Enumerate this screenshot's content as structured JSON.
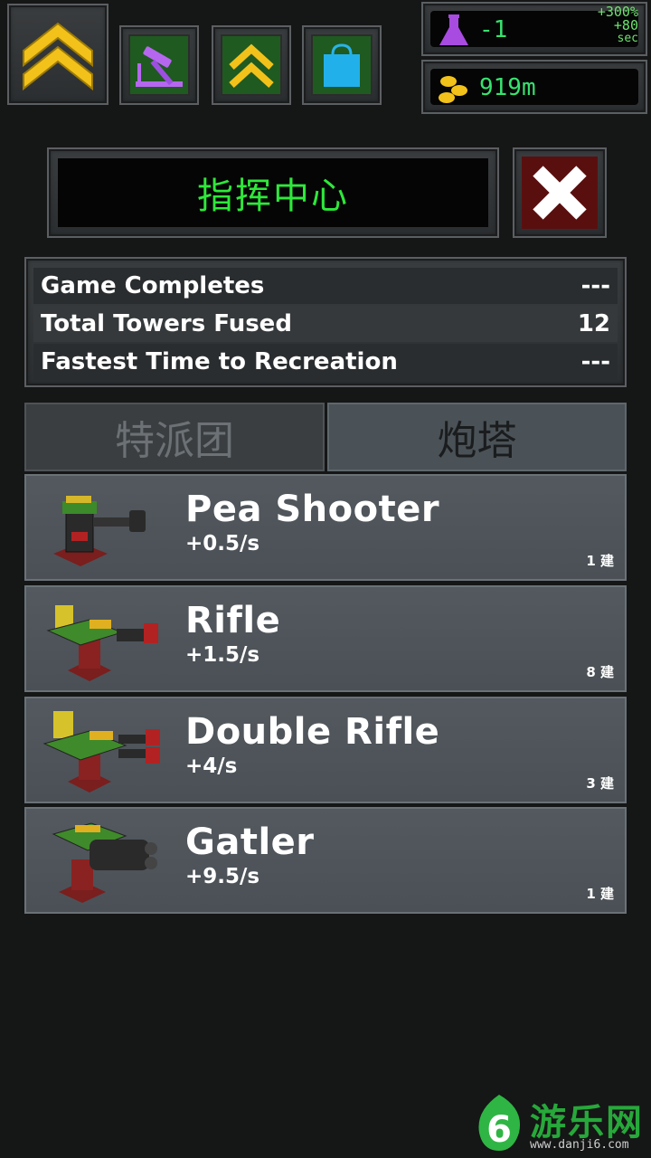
{
  "top_bar": {
    "rank_icon": "rank-chevron-icon",
    "buttons": [
      {
        "name": "build-hammer-button",
        "icon": "hammer-icon"
      },
      {
        "name": "upgrade-button",
        "icon": "double-chevron-icon"
      },
      {
        "name": "shop-button",
        "icon": "shopping-bag-icon"
      }
    ],
    "resources": {
      "research_value": "-1",
      "research_bonus_pct": "+300%",
      "research_bonus_rate": "+80",
      "research_bonus_unit": "sec",
      "gold_value": "919m"
    }
  },
  "title": {
    "text": "指挥中心",
    "close_icon": "close-x-icon"
  },
  "stats": [
    {
      "label": "Game Completes",
      "value": "---"
    },
    {
      "label": "Total Towers Fused",
      "value": "12"
    },
    {
      "label": "Fastest Time to Recreation",
      "value": "---"
    }
  ],
  "tabs": [
    {
      "label": "特派团",
      "active": false
    },
    {
      "label": "炮塔",
      "active": true
    }
  ],
  "towers": [
    {
      "name": "Pea Shooter",
      "rate": "+0.5/s",
      "count": "1 建",
      "icon": "pea-shooter-turret-icon"
    },
    {
      "name": "Rifle",
      "rate": "+1.5/s",
      "count": "8 建",
      "icon": "rifle-turret-icon"
    },
    {
      "name": "Double Rifle",
      "rate": "+4/s",
      "count": "3 建",
      "icon": "double-rifle-turret-icon"
    },
    {
      "name": "Gatler",
      "rate": "+9.5/s",
      "count": "1 建",
      "icon": "gatler-turret-icon"
    }
  ],
  "watermark": {
    "brand": "游乐网",
    "url": "www.danji6.com",
    "logo": "leaf-6-logo-icon"
  },
  "colors": {
    "accent_green": "#2ee83a",
    "gold": "#f2c21a",
    "purple": "#a84be0",
    "close_red": "#5a0f0f"
  }
}
